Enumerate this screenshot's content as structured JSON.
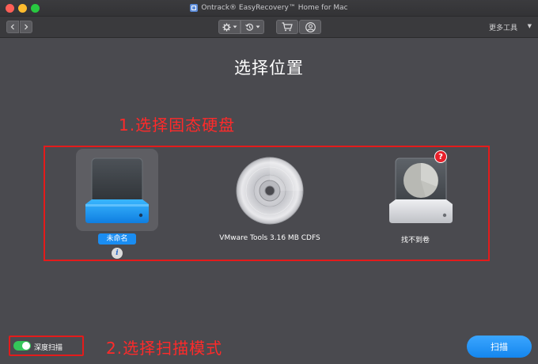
{
  "window": {
    "title": "Ontrack® EasyRecovery™ Home for Mac"
  },
  "toolbar": {
    "back_icon": "chevron-left-icon",
    "forward_icon": "chevron-right-icon",
    "gear_icon": "gear-icon",
    "history_icon": "history-icon",
    "cart_icon": "cart-icon",
    "user_icon": "user-icon",
    "more_tools_label": "更多工具"
  },
  "main": {
    "title": "选择位置",
    "annotation_step1": "1.选择固态硬盘",
    "annotation_step2": "2.选择扫描模式",
    "drives": [
      {
        "label": "未命名",
        "icon": "hard-drive-icon",
        "selected": true,
        "accent": "#1aa5ff"
      },
      {
        "label": "VMware Tools 3.16 MB CDFS",
        "icon": "cd-disc-icon",
        "selected": false
      },
      {
        "label": "找不到卷",
        "icon": "lost-volume-drive-icon",
        "selected": false,
        "badge": "?"
      }
    ]
  },
  "footer": {
    "deep_scan_label": "深度扫描",
    "deep_scan_on": true,
    "scan_button_label": "扫描"
  },
  "colors": {
    "background": "#4a4a4f",
    "accent_blue": "#1a8df2",
    "annotation_red": "#ff2a2a",
    "toggle_green": "#34c759"
  }
}
